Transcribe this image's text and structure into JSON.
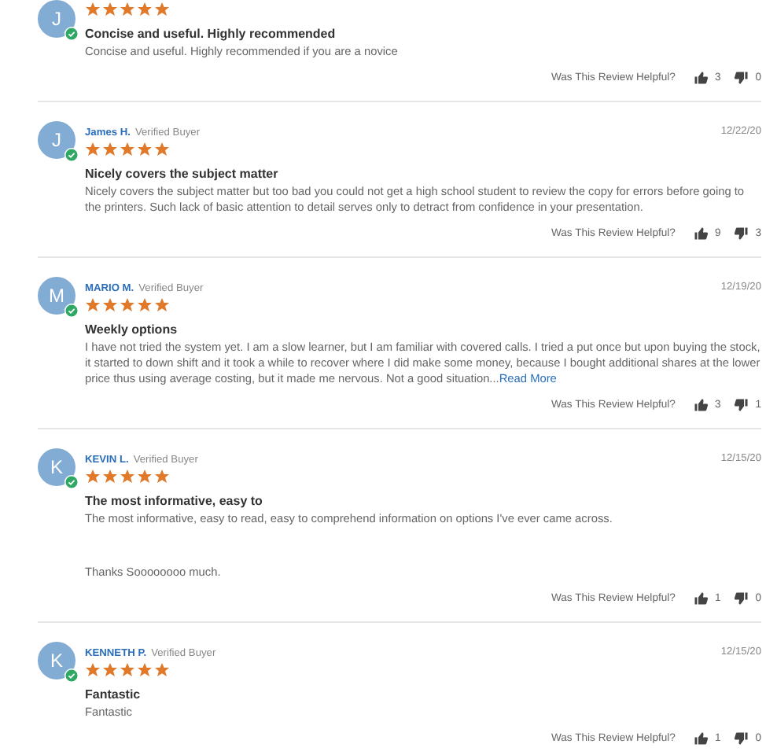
{
  "reviews": [
    {
      "avatar": "J",
      "verified": true,
      "stars": 5,
      "title": "Concise and useful. Highly recommended",
      "body": [
        "Concise and useful. Highly recommended if you are a novice"
      ],
      "helpful_label": "Was This Review Helpful?",
      "up_count": "3",
      "down_count": "0"
    },
    {
      "avatar": "J",
      "verified": true,
      "name": "James H.",
      "badge": "Verified Buyer",
      "date": "12/22/20",
      "stars": 5,
      "title": "Nicely covers the subject matter",
      "body": [
        "Nicely covers the subject matter but too bad you could not get a high school student to review the copy for errors before going to the printers. Such lack of basic attention to detail serves only to detract from confidence in your presentation."
      ],
      "helpful_label": "Was This Review Helpful?",
      "up_count": "9",
      "down_count": "3"
    },
    {
      "avatar": "M",
      "verified": true,
      "name": "MARIO M.",
      "badge": "Verified Buyer",
      "date": "12/19/20",
      "stars": 5,
      "title": "Weekly options",
      "body": [
        "I have not tried the system yet. I am a slow learner, but I am familiar with covered calls. I tried a put once but upon buying the stock, it started to down shift and it took a while to recover where I did make some money, because I bought additional shares at the lower price thus using average costing, but it made me nervous. Not a good situation..."
      ],
      "read_more": "Read More",
      "helpful_label": "Was This Review Helpful?",
      "up_count": "3",
      "down_count": "1"
    },
    {
      "avatar": "K",
      "verified": true,
      "name": "KEVIN L.",
      "badge": "Verified Buyer",
      "date": "12/15/20",
      "stars": 5,
      "title": "The most informative, easy to",
      "body": [
        "The most informative, easy to read, easy to comprehend information on options I've ever came across.",
        "Thanks Soooooooo much."
      ],
      "helpful_label": "Was This Review Helpful?",
      "up_count": "1",
      "down_count": "0"
    },
    {
      "avatar": "K",
      "verified": true,
      "name": "KENNETH P.",
      "badge": "Verified Buyer",
      "date": "12/15/20",
      "stars": 5,
      "title": "Fantastic",
      "body": [
        "Fantastic"
      ],
      "helpful_label": "Was This Review Helpful?",
      "up_count": "1",
      "down_count": "0"
    }
  ]
}
